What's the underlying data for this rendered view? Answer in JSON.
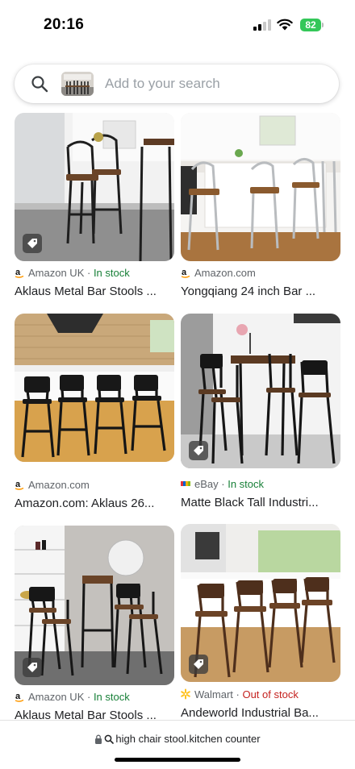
{
  "status_bar": {
    "time": "20:16",
    "battery": "82",
    "signal_bars": 2,
    "signal_max": 4,
    "battery_color": "#34c759"
  },
  "search": {
    "placeholder": "Add to your search",
    "icon": "search-icon"
  },
  "results": [
    {
      "source": "Amazon UK",
      "separator": " · ",
      "stock": "In stock",
      "stock_status": "in",
      "title": "Aklaus Metal Bar Stools ...",
      "logo": "amazon-logo"
    },
    {
      "source": "Amazon.com",
      "separator": "",
      "stock": "",
      "stock_status": "none",
      "title": "Yongqiang 24 inch Bar ...",
      "logo": "amazon-logo"
    },
    {
      "source": "Amazon.com",
      "separator": "",
      "stock": "",
      "stock_status": "none",
      "title": "Amazon.com: Aklaus 26...",
      "logo": "amazon-logo"
    },
    {
      "source": "eBay",
      "separator": " · ",
      "stock": "In stock",
      "stock_status": "in",
      "title": "Matte Black Tall Industri...",
      "logo": "ebay-logo"
    },
    {
      "source": "Amazon UK",
      "separator": " · ",
      "stock": "In stock",
      "stock_status": "in",
      "title": "Aklaus Metal Bar Stools ...",
      "logo": "amazon-logo"
    },
    {
      "source": "Walmart",
      "separator": " · ",
      "stock": "Out of stock",
      "stock_status": "out",
      "title": "Andeworld Industrial Ba...",
      "logo": "walmart-logo"
    }
  ],
  "url_bar": {
    "text": "high chair stool.kitchen counter",
    "lock_icon": "lock-icon"
  },
  "colors": {
    "in_stock": "#188038",
    "out_of_stock": "#c5221f",
    "muted": "#5f6368"
  }
}
